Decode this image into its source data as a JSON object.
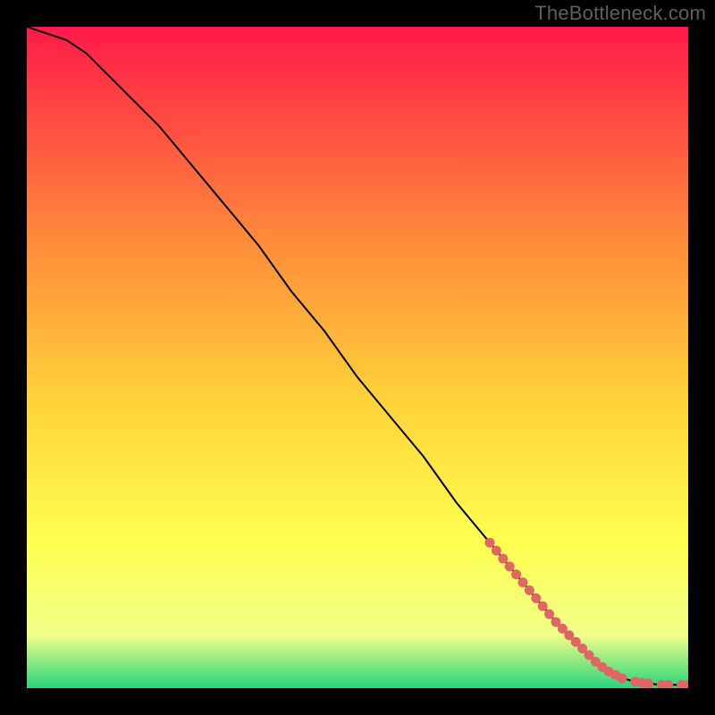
{
  "watermark": "TheBottleneck.com",
  "colors": {
    "page_bg": "#000000",
    "watermark": "#5f5f5f",
    "curve": "#000000",
    "marker": "#e06666",
    "gradient_top": "#ff1a49",
    "gradient_mid1": "#ff8a3a",
    "gradient_mid2": "#ffd63a",
    "gradient_mid3": "#ffff50",
    "gradient_mid4": "#f0ff88",
    "gradient_bottom": "#28d47c"
  },
  "chart_data": {
    "type": "line",
    "title": "",
    "xlabel": "",
    "ylabel": "",
    "xlim": [
      0,
      100
    ],
    "ylim": [
      0,
      100
    ],
    "series": [
      {
        "name": "bottleneck-curve",
        "x": [
          0,
          3,
          6,
          9,
          12,
          16,
          20,
          25,
          30,
          35,
          40,
          45,
          50,
          55,
          60,
          65,
          70,
          75,
          80,
          82,
          84,
          86,
          88,
          90,
          92,
          94,
          96,
          98,
          100
        ],
        "y": [
          100,
          99,
          98,
          96,
          93,
          89,
          85,
          79,
          73,
          67,
          60,
          54,
          47,
          41,
          35,
          28,
          22,
          16,
          10,
          8,
          6,
          4,
          2.5,
          1.5,
          1,
          0.7,
          0.5,
          0.5,
          0.5
        ]
      }
    ],
    "markers": {
      "name": "highlighted-points",
      "x": [
        70,
        71,
        72,
        73,
        74,
        75,
        76,
        77,
        78,
        79,
        80,
        81,
        82,
        83,
        84,
        85,
        86,
        87,
        88,
        89,
        90,
        92,
        93,
        94,
        96,
        97,
        99,
        100
      ],
      "y": [
        22,
        20.8,
        19.6,
        18.4,
        17.2,
        16,
        14.8,
        13.6,
        12.4,
        11.2,
        10,
        9,
        8,
        7,
        6,
        5,
        4,
        3.2,
        2.5,
        2,
        1.5,
        1,
        0.85,
        0.7,
        0.5,
        0.5,
        0.5,
        0.5
      ]
    }
  }
}
